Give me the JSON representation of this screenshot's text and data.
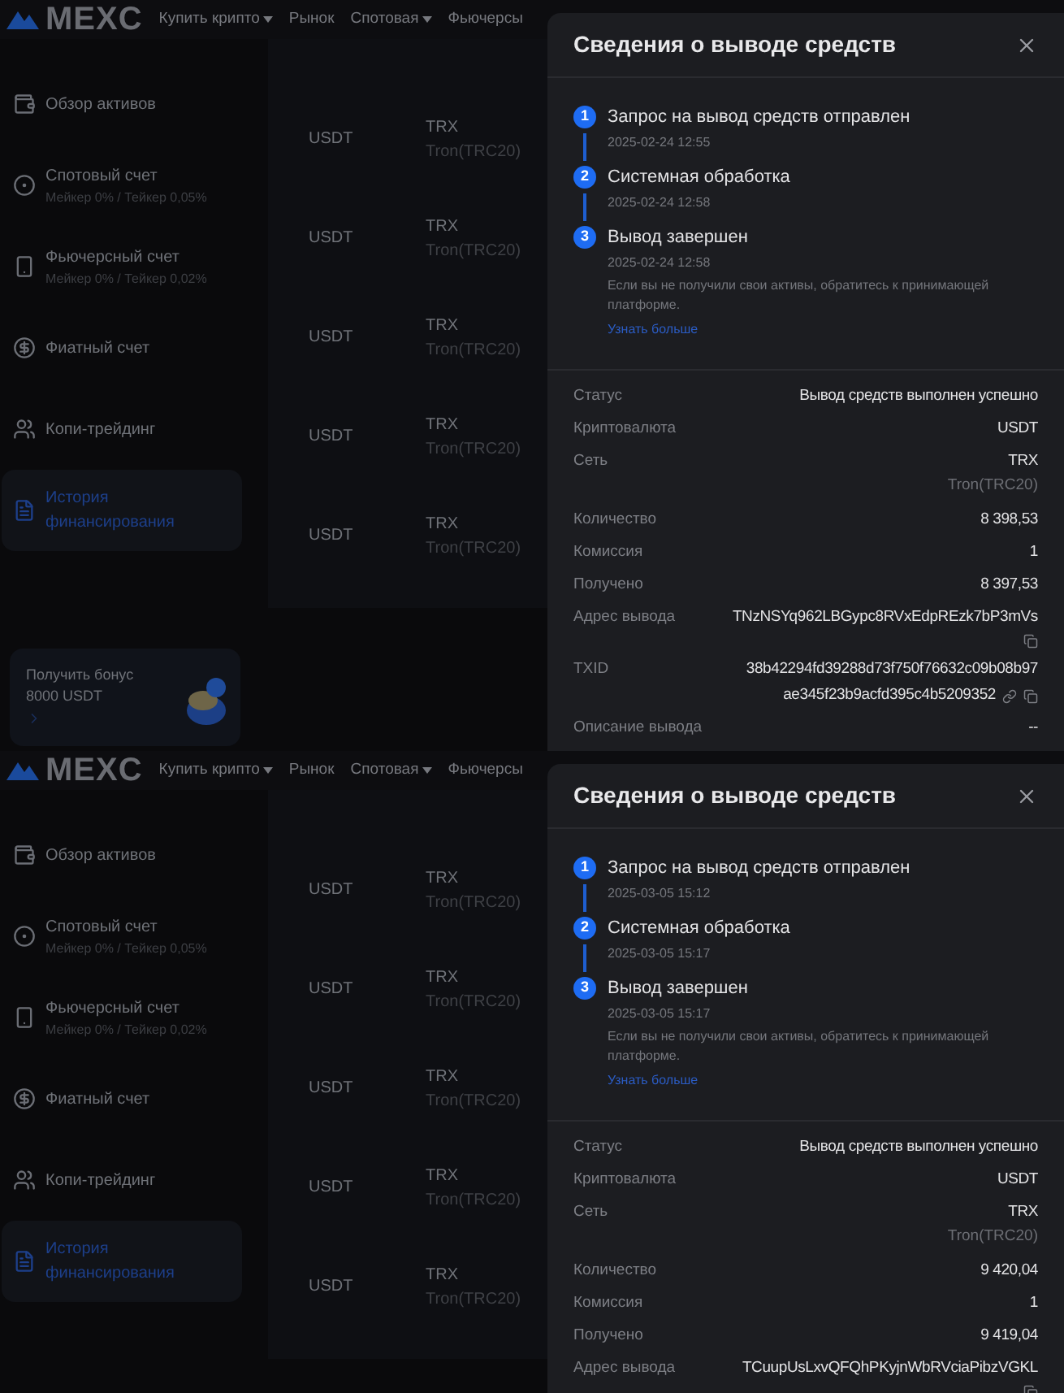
{
  "screens": [
    {
      "nav": {
        "logo": "MEXC",
        "items": [
          {
            "label": "Купить крипто",
            "dropdown": true
          },
          {
            "label": "Рынок",
            "dropdown": false
          },
          {
            "label": "Спотовая",
            "dropdown": true
          },
          {
            "label": "Фьючерсы",
            "dropdown": false
          }
        ]
      },
      "sidebar": {
        "items": [
          {
            "kind": "wallet",
            "label": "Обзор активов",
            "selected": false
          },
          {
            "kind": "spot",
            "label": "Спотовый счет",
            "sub": "Мейкер 0% / Тейкер 0,05%",
            "selected": false
          },
          {
            "kind": "futures",
            "label": "Фьючерсный счет",
            "sub": "Мейкер 0% / Тейкер 0,02%",
            "selected": false
          },
          {
            "kind": "fiat",
            "label": "Фиатный счет",
            "selected": false
          },
          {
            "kind": "copy",
            "label": "Копи-трейдинг",
            "selected": false
          },
          {
            "kind": "history",
            "label": "История финансирования",
            "selected": true
          }
        ]
      },
      "bonus": {
        "title": "Получить бонус",
        "amount": "8000 USDT"
      },
      "rows": [
        {
          "coin": "USDT",
          "network": "TRX",
          "network_full": "Tron(TRC20)"
        },
        {
          "coin": "USDT",
          "network": "TRX",
          "network_full": "Tron(TRC20)"
        },
        {
          "coin": "USDT",
          "network": "TRX",
          "network_full": "Tron(TRC20)"
        },
        {
          "coin": "USDT",
          "network": "TRX",
          "network_full": "Tron(TRC20)"
        },
        {
          "coin": "USDT",
          "network": "TRX",
          "network_full": "Tron(TRC20)"
        }
      ],
      "modal": {
        "title": "Сведения о выводе средств",
        "steps": [
          {
            "number": "1",
            "title": "Запрос на вывод средств отправлен",
            "time": "2025-02-24 12:55"
          },
          {
            "number": "2",
            "title": "Системная обработка",
            "time": "2025-02-24 12:58"
          },
          {
            "number": "3",
            "title": "Вывод завершен",
            "time": "2025-02-24 12:58",
            "note": "Если вы не получили свои активы, обратитесь к принимающей платформе.",
            "link": "Узнать больше"
          }
        ],
        "details": [
          {
            "kind": "text",
            "label": "Статус",
            "value": "Вывод средств выполнен успешно"
          },
          {
            "kind": "text",
            "label": "Криптовалюта",
            "value": "USDT"
          },
          {
            "kind": "network",
            "label": "Сеть",
            "value": "TRX",
            "sub": "Tron(TRC20)"
          },
          {
            "kind": "text",
            "label": "Количество",
            "value": "8 398,53"
          },
          {
            "kind": "text",
            "label": "Комиссия",
            "value": "1"
          },
          {
            "kind": "text",
            "label": "Получено",
            "value": "8 397,53"
          },
          {
            "kind": "address",
            "label": "Адрес вывода",
            "value": "TNzNSYq962LBGypc8RVxEdpREzk7bP3mVs"
          },
          {
            "kind": "hash",
            "label": "TXID",
            "value": "38b42294fd39288d73f750f76632c09b08b97",
            "value_2": "ae345f23b9acfd395c4b5209352"
          },
          {
            "kind": "text",
            "label": "Описание вывода",
            "value": "--"
          }
        ]
      }
    },
    {
      "nav": {
        "logo": "MEXC",
        "items": [
          {
            "label": "Купить крипто",
            "dropdown": true
          },
          {
            "label": "Рынок",
            "dropdown": false
          },
          {
            "label": "Спотовая",
            "dropdown": true
          },
          {
            "label": "Фьючерсы",
            "dropdown": false
          }
        ]
      },
      "sidebar": {
        "items": [
          {
            "kind": "wallet",
            "label": "Обзор активов",
            "selected": false
          },
          {
            "kind": "spot",
            "label": "Спотовый счет",
            "sub": "Мейкер 0% / Тейкер 0,05%",
            "selected": false
          },
          {
            "kind": "futures",
            "label": "Фьючерсный счет",
            "sub": "Мейкер 0% / Тейкер 0,02%",
            "selected": false
          },
          {
            "kind": "fiat",
            "label": "Фиатный счет",
            "selected": false
          },
          {
            "kind": "copy",
            "label": "Копи-трейдинг",
            "selected": false
          },
          {
            "kind": "history",
            "label": "История финансирования",
            "selected": true
          }
        ]
      },
      "rows": [
        {
          "coin": "USDT",
          "network": "TRX",
          "network_full": "Tron(TRC20)"
        },
        {
          "coin": "USDT",
          "network": "TRX",
          "network_full": "Tron(TRC20)"
        },
        {
          "coin": "USDT",
          "network": "TRX",
          "network_full": "Tron(TRC20)"
        },
        {
          "coin": "USDT",
          "network": "TRX",
          "network_full": "Tron(TRC20)"
        },
        {
          "coin": "USDT",
          "network": "TRX",
          "network_full": "Tron(TRC20)"
        }
      ],
      "modal": {
        "title": "Сведения о выводе средств",
        "steps": [
          {
            "number": "1",
            "title": "Запрос на вывод средств отправлен",
            "time": "2025-03-05 15:12"
          },
          {
            "number": "2",
            "title": "Системная обработка",
            "time": "2025-03-05 15:17"
          },
          {
            "number": "3",
            "title": "Вывод завершен",
            "time": "2025-03-05 15:17",
            "note": "Если вы не получили свои активы, обратитесь к принимающей платформе.",
            "link": "Узнать больше"
          }
        ],
        "details": [
          {
            "kind": "text",
            "label": "Статус",
            "value": "Вывод средств выполнен успешно"
          },
          {
            "kind": "text",
            "label": "Криптовалюта",
            "value": "USDT"
          },
          {
            "kind": "network",
            "label": "Сеть",
            "value": "TRX",
            "sub": "Tron(TRC20)"
          },
          {
            "kind": "text",
            "label": "Количество",
            "value": "9 420,04"
          },
          {
            "kind": "text",
            "label": "Комиссия",
            "value": "1"
          },
          {
            "kind": "text",
            "label": "Получено",
            "value": "9 419,04"
          },
          {
            "kind": "address",
            "label": "Адрес вывода",
            "value": "TCuupUsLxvQFQhPKyjnWbRVciaPibzVGKL"
          }
        ]
      }
    }
  ]
}
